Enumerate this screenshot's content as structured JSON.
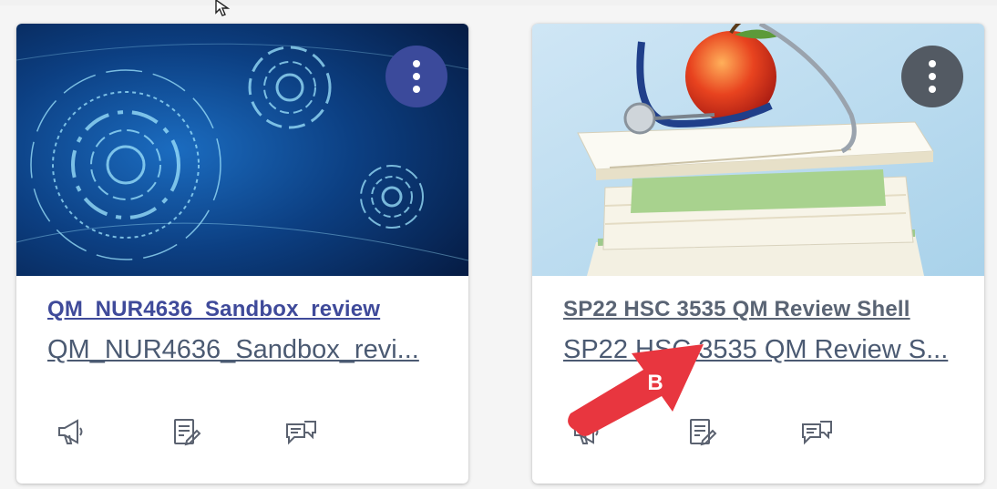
{
  "courses": [
    {
      "title": "QM_NUR4636_Sandbox_review",
      "subtitle": "QM_NUR4636_Sandbox_revi...",
      "title_color": "#3f4a9a",
      "kebab_color": "#3b4a9b",
      "image": "circuit-pattern-blue",
      "actions": [
        "announcements-icon",
        "assignments-icon",
        "discussions-icon"
      ]
    },
    {
      "title": "SP22 HSC 3535 QM Review Shell",
      "subtitle": "SP22 HSC 3535 QM Review S...",
      "title_color": "#5a6474",
      "kebab_color": "#535a63",
      "image": "books-stethoscope-apple",
      "actions": [
        "announcements-icon",
        "assignments-icon",
        "discussions-icon"
      ]
    }
  ],
  "annotation": {
    "label": "B",
    "color": "#e8363f"
  }
}
